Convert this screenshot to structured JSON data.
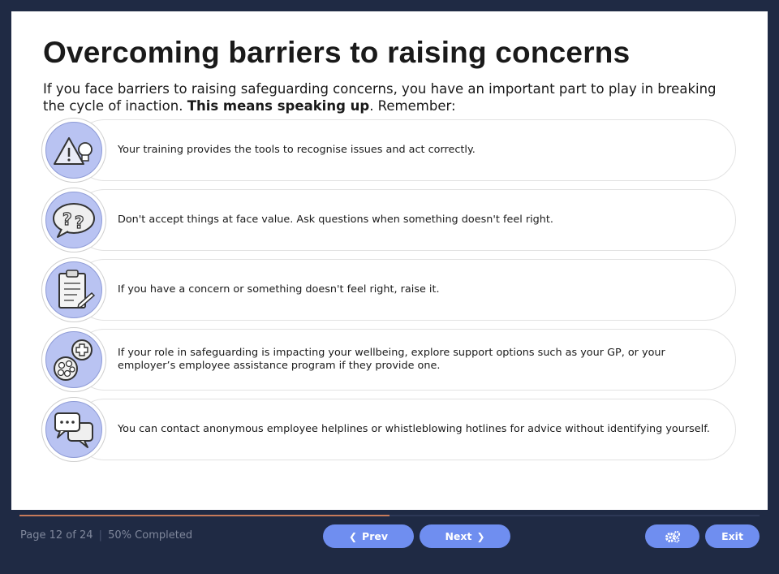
{
  "slide": {
    "title": "Overcoming barriers to raising concerns",
    "intro_text": "If you face barriers to raising safeguarding concerns, you have an important part to play in breaking the cycle of inaction. ",
    "intro_bold": "This means speaking up",
    "intro_tail": ". Remember:"
  },
  "cards": [
    {
      "icon": "warning-lightbulb-icon",
      "text": "Your training provides the tools to recognise issues and act correctly."
    },
    {
      "icon": "question-bubble-icon",
      "text": "Don't accept things at face value. Ask questions when something doesn't feel right."
    },
    {
      "icon": "clipboard-icon",
      "text": "If you have a concern or something doesn't feel right, raise it."
    },
    {
      "icon": "wellbeing-support-icon",
      "text": "If your role in safeguarding is impacting your wellbeing, explore support options such as your GP, or your employer’s employee assistance program if they provide one."
    },
    {
      "icon": "chat-bubbles-icon",
      "text": "You can contact anonymous employee helplines or whistleblowing hotlines for advice without identifying yourself."
    }
  ],
  "footer": {
    "page_label": "Page 12 of 24",
    "separator": "|",
    "completed_label": "50% Completed",
    "progress": 0.5,
    "prev_label": "Prev",
    "next_label": "Next",
    "settings_icon": "gears-icon",
    "exit_label": "Exit"
  },
  "colors": {
    "background": "#1f2a44",
    "accent": "#6f8ef0",
    "icon_fill": "#b9c3f2",
    "progress": "#c67a5a"
  }
}
